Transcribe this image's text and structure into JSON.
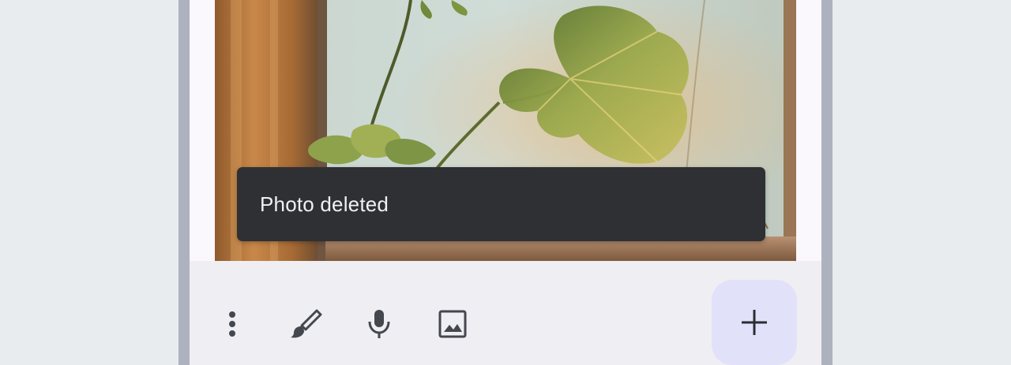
{
  "snackbar": {
    "message": "Photo deleted"
  },
  "photo": {
    "subject": "houseplant-by-window"
  },
  "bottom_bar": {
    "tools": [
      {
        "icon": "more-vert-icon"
      },
      {
        "icon": "brush-icon"
      },
      {
        "icon": "mic-icon"
      },
      {
        "icon": "image-icon"
      }
    ],
    "fab": {
      "icon": "add-icon"
    }
  },
  "colors": {
    "background": "#e8ecef",
    "frame": "#aeb1be",
    "snackbar": "#2f3033",
    "bottom_bar": "#eeeef3",
    "fab": "#e2e1fa",
    "icon": "#44474e"
  }
}
